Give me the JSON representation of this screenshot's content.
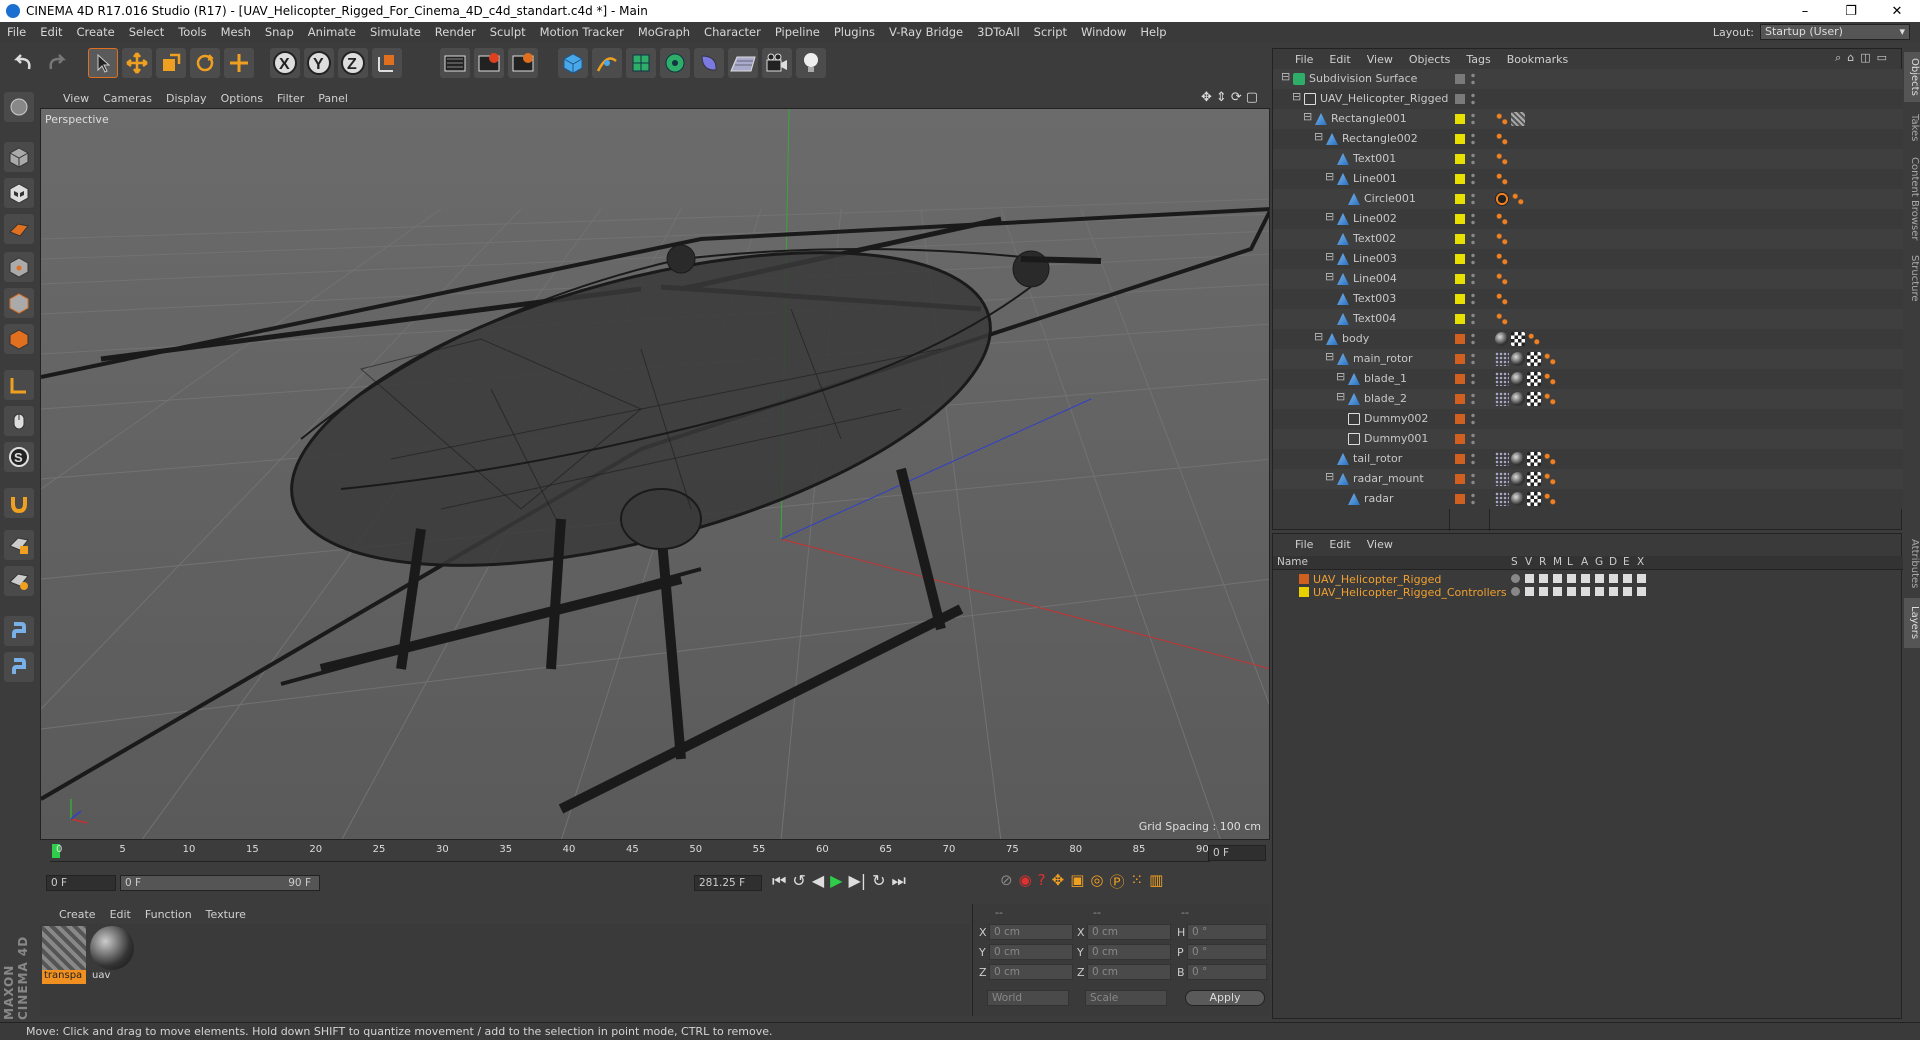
{
  "window": {
    "title": "CINEMA 4D R17.016 Studio (R17) - [UAV_Helicopter_Rigged_For_Cinema_4D_c4d_standart.c4d *] - Main",
    "controls": [
      "–",
      "❐",
      "✕"
    ]
  },
  "menu": [
    "File",
    "Edit",
    "Create",
    "Select",
    "Tools",
    "Mesh",
    "Snap",
    "Animate",
    "Simulate",
    "Render",
    "Sculpt",
    "Motion Tracker",
    "MoGraph",
    "Character",
    "Pipeline",
    "Plugins",
    "V-Ray Bridge",
    "3DToAll",
    "Script",
    "Window",
    "Help"
  ],
  "layout": {
    "label": "Layout:",
    "value": "Startup (User)"
  },
  "toolbar": {
    "icons": [
      "undo-icon",
      "redo-icon",
      "select-arrow-icon",
      "move-icon",
      "scale-icon",
      "rotate-icon",
      "coordinate-icon",
      "x-axis-icon",
      "y-axis-icon",
      "z-axis-icon",
      "world-coords-icon",
      "render-view-icon",
      "render-picture-queue-icon",
      "render-settings-icon",
      "cube-icon",
      "pen-spline-icon",
      "subdivision-icon",
      "array-icon",
      "deformer-icon",
      "floor-icon",
      "camera-icon",
      "light-icon"
    ]
  },
  "viewport": {
    "menu": [
      "View",
      "Cameras",
      "Display",
      "Options",
      "Filter",
      "Panel"
    ],
    "label": "Perspective",
    "grid_spacing": "Grid Spacing : 100 cm"
  },
  "timeline": {
    "ticks": [
      "0",
      "5",
      "10",
      "15",
      "20",
      "25",
      "30",
      "35",
      "40",
      "45",
      "50",
      "55",
      "60",
      "65",
      "70",
      "75",
      "80",
      "85",
      "90"
    ],
    "current_frame": "0 F",
    "start_field": "0 F",
    "range_start": "0 F",
    "range_end": "90 F",
    "fps_field": "281.25 F"
  },
  "material_manager": {
    "menu": [
      "Create",
      "Edit",
      "Function",
      "Texture"
    ],
    "materials": [
      {
        "name": "transpa",
        "selected": true
      },
      {
        "name": "uav",
        "selected": false
      }
    ]
  },
  "coordinates": {
    "header": [
      "--",
      "--",
      "--"
    ],
    "rows": [
      {
        "axis": "X",
        "pos": "0 cm",
        "axis2": "X",
        "size": "0 cm",
        "rlabel": "H",
        "rot": "0 °"
      },
      {
        "axis": "Y",
        "pos": "0 cm",
        "axis2": "Y",
        "size": "0 cm",
        "rlabel": "P",
        "rot": "0 °"
      },
      {
        "axis": "Z",
        "pos": "0 cm",
        "axis2": "Z",
        "size": "0 cm",
        "rlabel": "B",
        "rot": "0 °"
      }
    ],
    "mode": "World",
    "scale_mode": "Scale",
    "apply": "Apply"
  },
  "object_manager": {
    "menu": [
      "File",
      "Edit",
      "View",
      "Objects",
      "Tags",
      "Bookmarks"
    ],
    "objects": [
      {
        "name": "Subdivision Surface",
        "depth": 0,
        "color": "#7a7a7a",
        "type": "subdiv",
        "expand": true
      },
      {
        "name": "UAV_Helicopter_Rigged",
        "depth": 1,
        "color": "#7a7a7a",
        "type": "null",
        "expand": true
      },
      {
        "name": "Rectangle001",
        "depth": 2,
        "color": "#e8e000",
        "type": "spline",
        "expand": true
      },
      {
        "name": "Rectangle002",
        "depth": 3,
        "color": "#e8e000",
        "type": "spline",
        "expand": true
      },
      {
        "name": "Text001",
        "depth": 4,
        "color": "#e8e000",
        "type": "spline",
        "expand": false
      },
      {
        "name": "Line001",
        "depth": 4,
        "color": "#e8e000",
        "type": "spline",
        "expand": true
      },
      {
        "name": "Circle001",
        "depth": 5,
        "color": "#e8e000",
        "type": "spline",
        "expand": false
      },
      {
        "name": "Line002",
        "depth": 4,
        "color": "#e8e000",
        "type": "spline",
        "expand": true
      },
      {
        "name": "Text002",
        "depth": 4,
        "color": "#e8e000",
        "type": "spline",
        "expand": false
      },
      {
        "name": "Line003",
        "depth": 4,
        "color": "#e8e000",
        "type": "spline",
        "expand": true
      },
      {
        "name": "Line004",
        "depth": 4,
        "color": "#e8e000",
        "type": "spline",
        "expand": true
      },
      {
        "name": "Text003",
        "depth": 4,
        "color": "#e8e000",
        "type": "spline",
        "expand": false
      },
      {
        "name": "Text004",
        "depth": 4,
        "color": "#e8e000",
        "type": "spline",
        "expand": false
      },
      {
        "name": "body",
        "depth": 3,
        "color": "#d06020",
        "type": "poly",
        "expand": true
      },
      {
        "name": "main_rotor",
        "depth": 4,
        "color": "#d06020",
        "type": "poly",
        "expand": true
      },
      {
        "name": "blade_1",
        "depth": 5,
        "color": "#d06020",
        "type": "poly",
        "expand": true
      },
      {
        "name": "blade_2",
        "depth": 5,
        "color": "#d06020",
        "type": "poly",
        "expand": true
      },
      {
        "name": "Dummy002",
        "depth": 5,
        "color": "#d06020",
        "type": "null",
        "expand": false
      },
      {
        "name": "Dummy001",
        "depth": 5,
        "color": "#d06020",
        "type": "null",
        "expand": false
      },
      {
        "name": "tail_rotor",
        "depth": 4,
        "color": "#d06020",
        "type": "poly",
        "expand": false
      },
      {
        "name": "radar_mount",
        "depth": 4,
        "color": "#d06020",
        "type": "poly",
        "expand": true
      },
      {
        "name": "radar",
        "depth": 5,
        "color": "#d06020",
        "type": "poly",
        "expand": false
      }
    ]
  },
  "layer_manager": {
    "menu": [
      "File",
      "Edit",
      "View"
    ],
    "columns": [
      "Name",
      "S",
      "V",
      "R",
      "M",
      "L",
      "A",
      "G",
      "D",
      "E",
      "X"
    ],
    "layers": [
      {
        "name": "UAV_Helicopter_Rigged",
        "color": "#d06020"
      },
      {
        "name": "UAV_Helicopter_Rigged_Controllers",
        "color": "#e8d000"
      }
    ]
  },
  "side_tabs": [
    "Objects",
    "Takes",
    "Content Browser",
    "Structure",
    "Attributes",
    "Layers"
  ],
  "status": "Move: Click and drag to move elements. Hold down SHIFT to quantize movement / add to the selection in point mode, CTRL to remove.",
  "brand": "MAXON CINEMA 4D"
}
